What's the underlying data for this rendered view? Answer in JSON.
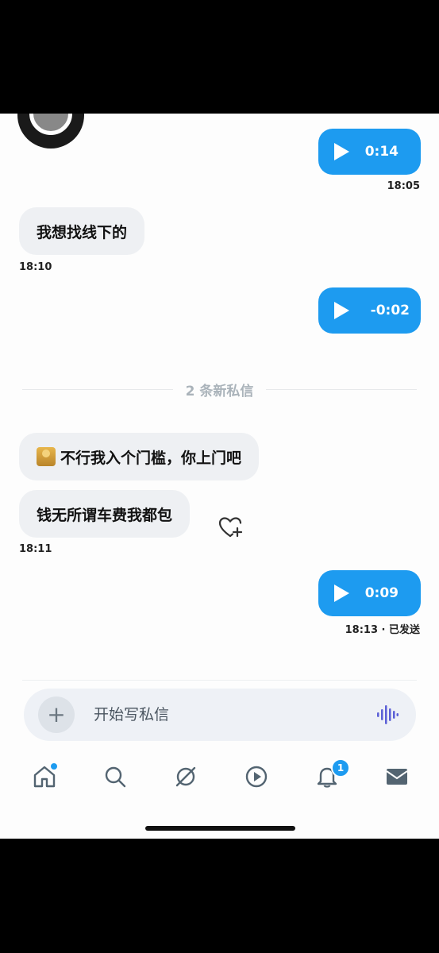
{
  "messages": {
    "voice1": {
      "duration": "0:14",
      "time": "18:05"
    },
    "text1": {
      "text": "我想找线下的",
      "time": "18:10"
    },
    "voice2": {
      "duration": "-0:02"
    },
    "divider": "2 条新私信",
    "text2": {
      "text": "不行我入个门槛，你上门吧"
    },
    "text3": {
      "text": "钱无所谓车费我都包",
      "time": "18:11"
    },
    "voice3": {
      "duration": "0:09",
      "status": "18:13 · 已发送"
    }
  },
  "composer": {
    "placeholder": "开始写私信"
  },
  "nav": {
    "notification_count": "1"
  },
  "colors": {
    "accent": "#1d9bf0",
    "bubble": "#eef0f3"
  }
}
